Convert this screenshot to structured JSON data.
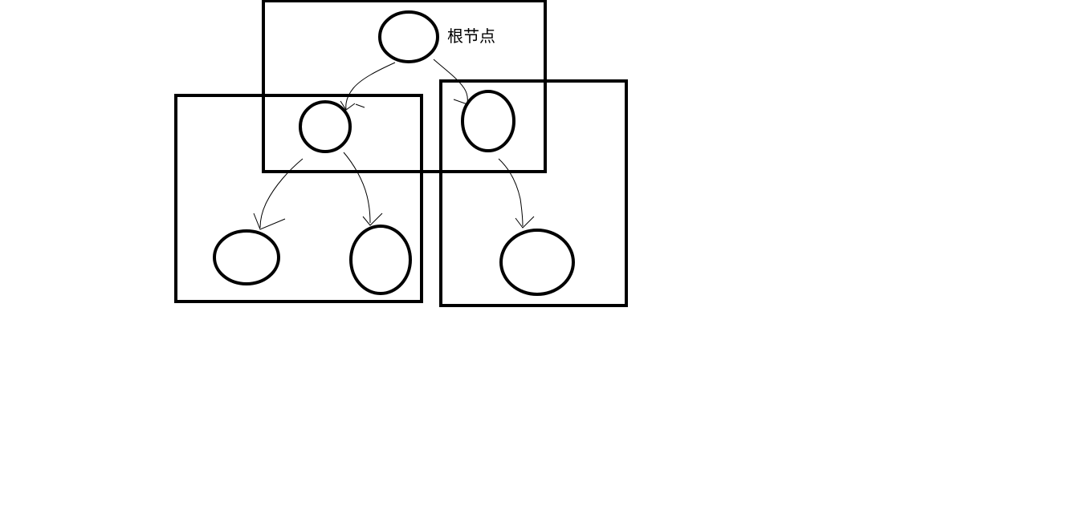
{
  "diagram": {
    "root_label": "根节点",
    "stroke_color": "#000000",
    "background_color": "#ffffff"
  }
}
